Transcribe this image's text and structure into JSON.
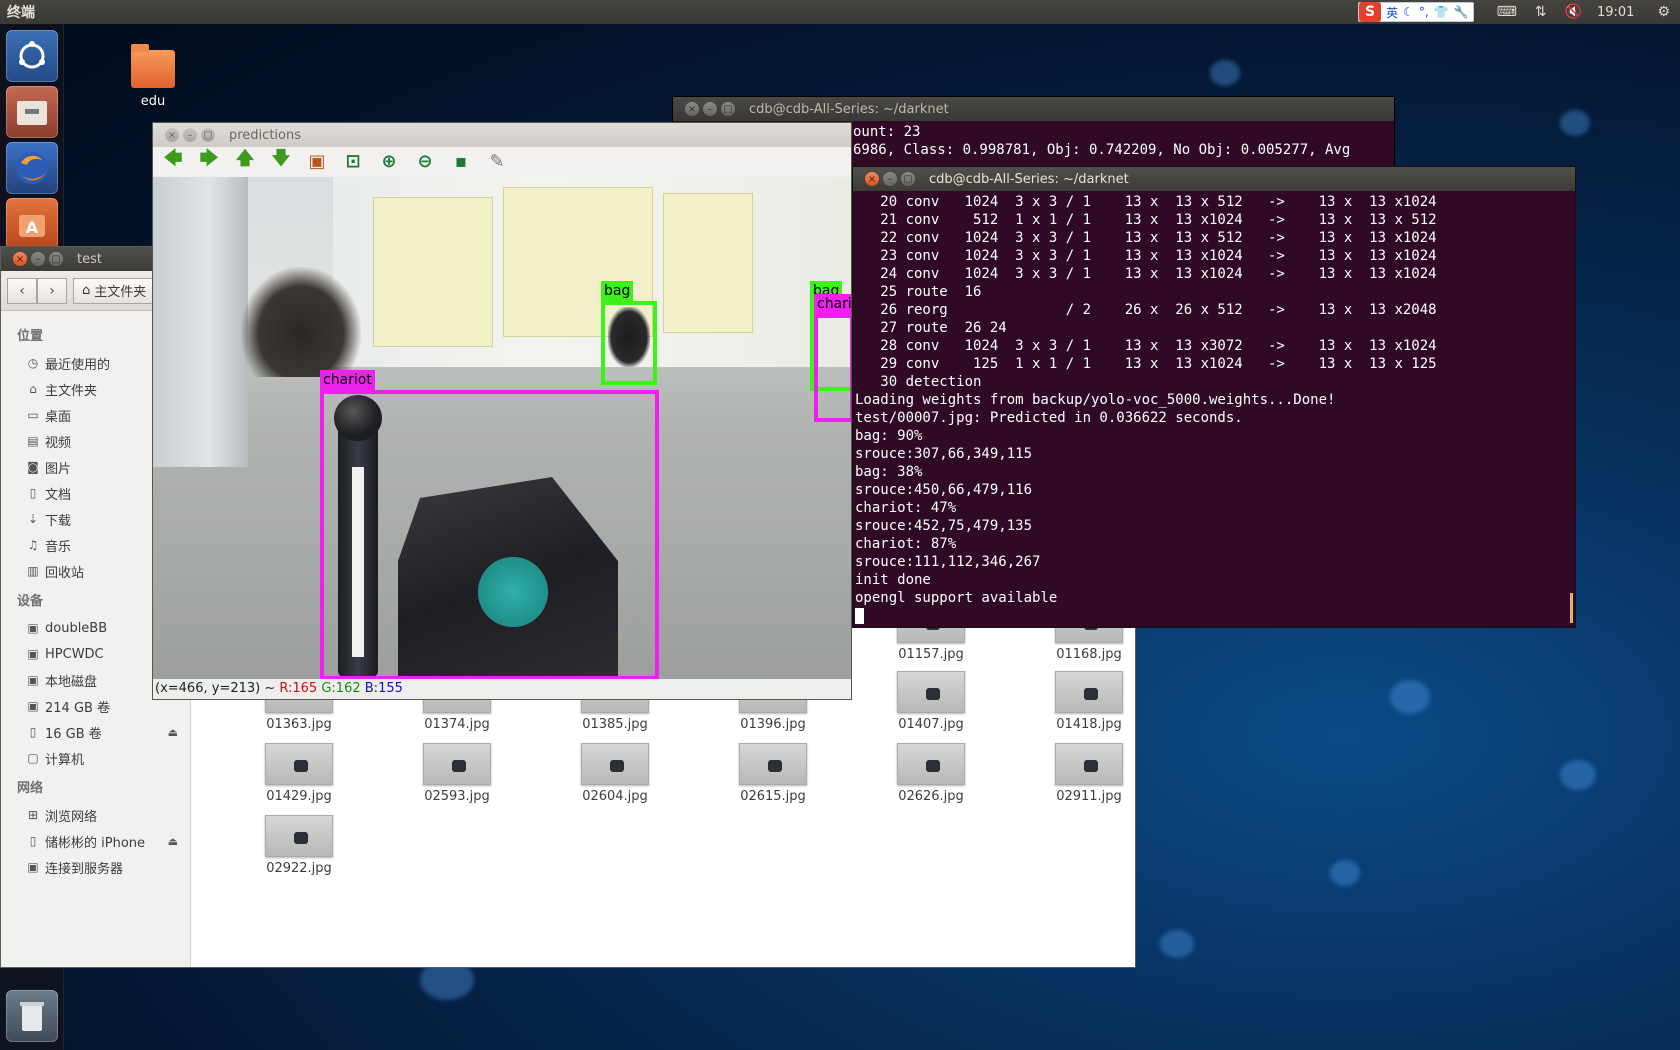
{
  "top_panel": {
    "title": "终端",
    "ime": {
      "brand": "S",
      "mode": "英",
      "icons": [
        "moon-icon",
        "punct-icon",
        "shirt-icon",
        "wrench-icon"
      ]
    },
    "tray_icons": [
      "keyboard-icon",
      "network-icon",
      "volume-muted-icon",
      "gear-icon"
    ],
    "clock": "19:01"
  },
  "launcher": [
    "dash-icon",
    "files-icon",
    "firefox-icon",
    "software-center-icon",
    "trash-icon"
  ],
  "desktop": {
    "icons": [
      {
        "label": "edu",
        "icon": "folder-icon"
      }
    ]
  },
  "files_window": {
    "title": "test",
    "breadcrumb": "主文件夹",
    "sidebar": {
      "places_heading": "位置",
      "places": [
        {
          "label": "最近使用的",
          "icon": "clock-icon"
        },
        {
          "label": "主文件夹",
          "icon": "home-icon"
        },
        {
          "label": "桌面",
          "icon": "desktop-icon"
        },
        {
          "label": "视频",
          "icon": "video-icon"
        },
        {
          "label": "图片",
          "icon": "camera-icon"
        },
        {
          "label": "文档",
          "icon": "document-icon"
        },
        {
          "label": "下载",
          "icon": "download-icon"
        },
        {
          "label": "音乐",
          "icon": "music-icon"
        },
        {
          "label": "回收站",
          "icon": "trash-icon"
        }
      ],
      "devices_heading": "设备",
      "devices": [
        {
          "label": "doubleBB",
          "icon": "drive-icon"
        },
        {
          "label": "HPCWDC",
          "icon": "drive-icon"
        },
        {
          "label": "本地磁盘",
          "icon": "drive-icon"
        },
        {
          "label": "214 GB 卷",
          "icon": "drive-icon"
        },
        {
          "label": "16 GB 卷",
          "icon": "usb-icon",
          "eject": true
        },
        {
          "label": "计算机",
          "icon": "computer-icon"
        }
      ],
      "network_heading": "网络",
      "network": [
        {
          "label": "浏览网络",
          "icon": "network-icon"
        },
        {
          "label": "储彬彬的 iPhone",
          "icon": "phone-icon",
          "eject": true
        },
        {
          "label": "连接到服务器",
          "icon": "server-icon"
        }
      ]
    },
    "files": [
      "01157.jpg",
      "01168.jpg",
      "01363.jpg",
      "01374.jpg",
      "01385.jpg",
      "01396.jpg",
      "01407.jpg",
      "01418.jpg",
      "01429.jpg",
      "02593.jpg",
      "02604.jpg",
      "02615.jpg",
      "02626.jpg",
      "02911.jpg",
      "02922.jpg"
    ]
  },
  "terminal_back": {
    "title": "cdb@cdb-All-Series: ~/darknet",
    "lines": [
      "ount: 23",
      "6986, Class: 0.998781, Obj: 0.742209, No Obj: 0.005277, Avg"
    ]
  },
  "terminal_front": {
    "title": "cdb@cdb-All-Series: ~/darknet",
    "lines": [
      "   20 conv   1024  3 x 3 / 1    13 x  13 x 512   ->    13 x  13 x1024",
      "   21 conv    512  1 x 1 / 1    13 x  13 x1024   ->    13 x  13 x 512",
      "   22 conv   1024  3 x 3 / 1    13 x  13 x 512   ->    13 x  13 x1024",
      "   23 conv   1024  3 x 3 / 1    13 x  13 x1024   ->    13 x  13 x1024",
      "   24 conv   1024  3 x 3 / 1    13 x  13 x1024   ->    13 x  13 x1024",
      "   25 route  16",
      "   26 reorg              / 2    26 x  26 x 512   ->    13 x  13 x2048",
      "   27 route  26 24",
      "   28 conv   1024  3 x 3 / 1    13 x  13 x3072   ->    13 x  13 x1024",
      "   29 conv    125  1 x 1 / 1    13 x  13 x1024   ->    13 x  13 x 125",
      "   30 detection",
      "Loading weights from backup/yolo-voc_5000.weights...Done!",
      "test/00007.jpg: Predicted in 0.036622 seconds.",
      "bag: 90%",
      "srouce:307,66,349,115",
      "bag: 38%",
      "srouce:450,66,479,116",
      "chariot: 47%",
      "srouce:452,75,479,135",
      "chariot: 87%",
      "srouce:111,112,346,267",
      "init done",
      "opengl support available"
    ]
  },
  "predictions_window": {
    "title": "predictions",
    "toolbar": [
      {
        "name": "arrow-left-icon",
        "glyph": "🡄",
        "color": "#3c9a1e"
      },
      {
        "name": "arrow-right-icon",
        "glyph": "🡆",
        "color": "#3c9a1e"
      },
      {
        "name": "arrow-up-icon",
        "glyph": "🡅",
        "color": "#3c9a1e"
      },
      {
        "name": "arrow-down-icon",
        "glyph": "🡇",
        "color": "#3c9a1e"
      },
      {
        "name": "image-icon",
        "glyph": "▣",
        "color": "#b9571f"
      },
      {
        "name": "zoom-fit-icon",
        "glyph": "⊡",
        "color": "#1f7a3a"
      },
      {
        "name": "zoom-in-icon",
        "glyph": "⊕",
        "color": "#1f7a3a"
      },
      {
        "name": "zoom-out-icon",
        "glyph": "⊖",
        "color": "#1f7a3a"
      },
      {
        "name": "save-icon",
        "glyph": "▪",
        "color": "#1f7a3a"
      },
      {
        "name": "settings-brush-icon",
        "glyph": "✎",
        "color": "#777"
      }
    ],
    "detections": [
      {
        "label": "bag",
        "color": "#3ef01c"
      },
      {
        "label": "bag",
        "color": "#3ef01c"
      },
      {
        "label": "chariot",
        "color": "#ee20ee"
      },
      {
        "label": "chariot",
        "color": "#ee20ee"
      }
    ],
    "status": {
      "coords": "(x=466, y=213) ~",
      "r": "R:165",
      "g": "G:162",
      "b": "B:155"
    }
  }
}
